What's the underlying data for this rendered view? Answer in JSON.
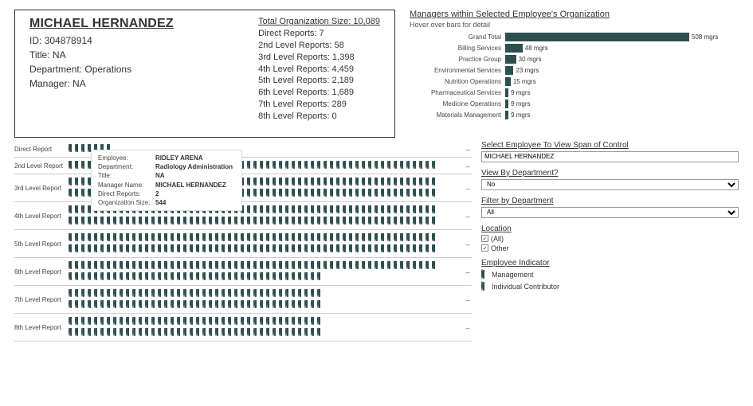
{
  "employee": {
    "name": "MICHAEL HERNANDEZ",
    "id_label": "ID:",
    "id": "304878914",
    "title_label": "Title:",
    "title": "NA",
    "dept_label": "Department:",
    "dept": "Operations",
    "manager_label": "Manager:",
    "manager": "NA"
  },
  "org": {
    "title": "Total Organization Size: 10,089",
    "levels": [
      "Direct Reports: 7",
      "2nd Level Reports: 58",
      "3rd Level Reports: 1,398",
      "4th Level Reports: 4,459",
      "5th Level Reports: 2,189",
      "6th Level Reports: 1,689",
      "7th Level Reports: 289",
      "8th Level Reports: 0"
    ]
  },
  "managers_panel": {
    "title": "Managers within Selected Employee's Organization",
    "subtitle": "Hover over bars for detail"
  },
  "chart_data": {
    "type": "bar",
    "orientation": "horizontal",
    "title": "Managers within Selected Employee's Organization",
    "categories": [
      "Grand Total",
      "Billing Services",
      "Practice Group",
      "Environmental Services",
      "Nutrition Operations",
      "Pharmaceutical Services",
      "Medicine Operations",
      "Materials Management"
    ],
    "values": [
      508,
      48,
      30,
      23,
      15,
      9,
      9,
      9
    ],
    "value_labels": [
      "508 mgrs",
      "48 mgrs",
      "30 mgrs",
      "23 mgrs",
      "15 mgrs",
      "9 mgrs",
      "9 mgrs",
      "9 mgrs"
    ],
    "xlim": [
      0,
      550
    ]
  },
  "levels": [
    {
      "label": "Direct Report",
      "rows": [
        {
          "mgr": 7,
          "ind": 0
        }
      ]
    },
    {
      "label": "2nd Level Report",
      "rows": [
        {
          "mgr": 15,
          "ind": 43
        },
        {
          "mgr": 0,
          "ind": 0
        }
      ]
    },
    {
      "label": "3rd Level Report",
      "rows": [
        {
          "mgr": 58,
          "ind": 0
        },
        {
          "mgr": 58,
          "ind": 0
        }
      ]
    },
    {
      "label": "4th Level Report",
      "rows": [
        {
          "mgr": 58,
          "ind": 0
        },
        {
          "mgr": 58,
          "ind": 0
        }
      ]
    },
    {
      "label": "5th Level Report",
      "rows": [
        {
          "mgr": 58,
          "ind": 0
        },
        {
          "mgr": 58,
          "ind": 0
        }
      ]
    },
    {
      "label": "6th Level Report",
      "rows": [
        {
          "mgr": 58,
          "ind": 0
        },
        {
          "mgr": 0,
          "ind": 40
        }
      ]
    },
    {
      "label": "7th Level Report",
      "rows": [
        {
          "mgr": 0,
          "ind": 40
        },
        {
          "mgr": 0,
          "ind": 40
        }
      ]
    },
    {
      "label": "8th Level Report",
      "rows": [
        {
          "mgr": 0,
          "ind": 40
        },
        {
          "mgr": 0,
          "ind": 40
        }
      ]
    }
  ],
  "tooltip": {
    "k_emp": "Employee:",
    "v_emp": "RIDLEY ARENA",
    "k_dept": "Department:",
    "v_dept": "Radiology Administration",
    "k_title": "Title:",
    "v_title": "NA",
    "k_mgr": "Manager Name:",
    "v_mgr": "MICHAEL HERNANDEZ",
    "k_dr": "Direct Reports:",
    "v_dr": "2",
    "k_org": "Organization Size:",
    "v_org": "544"
  },
  "controls": {
    "select_emp_label": "Select Employee To View Span of Control",
    "select_emp_value": "MICHAEL HERNANDEZ",
    "view_dept_label": "View By Department?",
    "view_dept_value": "No",
    "filter_dept_label": "Filter by Department",
    "filter_dept_value": "All",
    "location_label": "Location",
    "location_all": "(All)",
    "location_other": "Other",
    "emp_ind_label": "Employee Indicator",
    "emp_ind_mgmt": "Management",
    "emp_ind_ic": "Individual Contributor"
  }
}
